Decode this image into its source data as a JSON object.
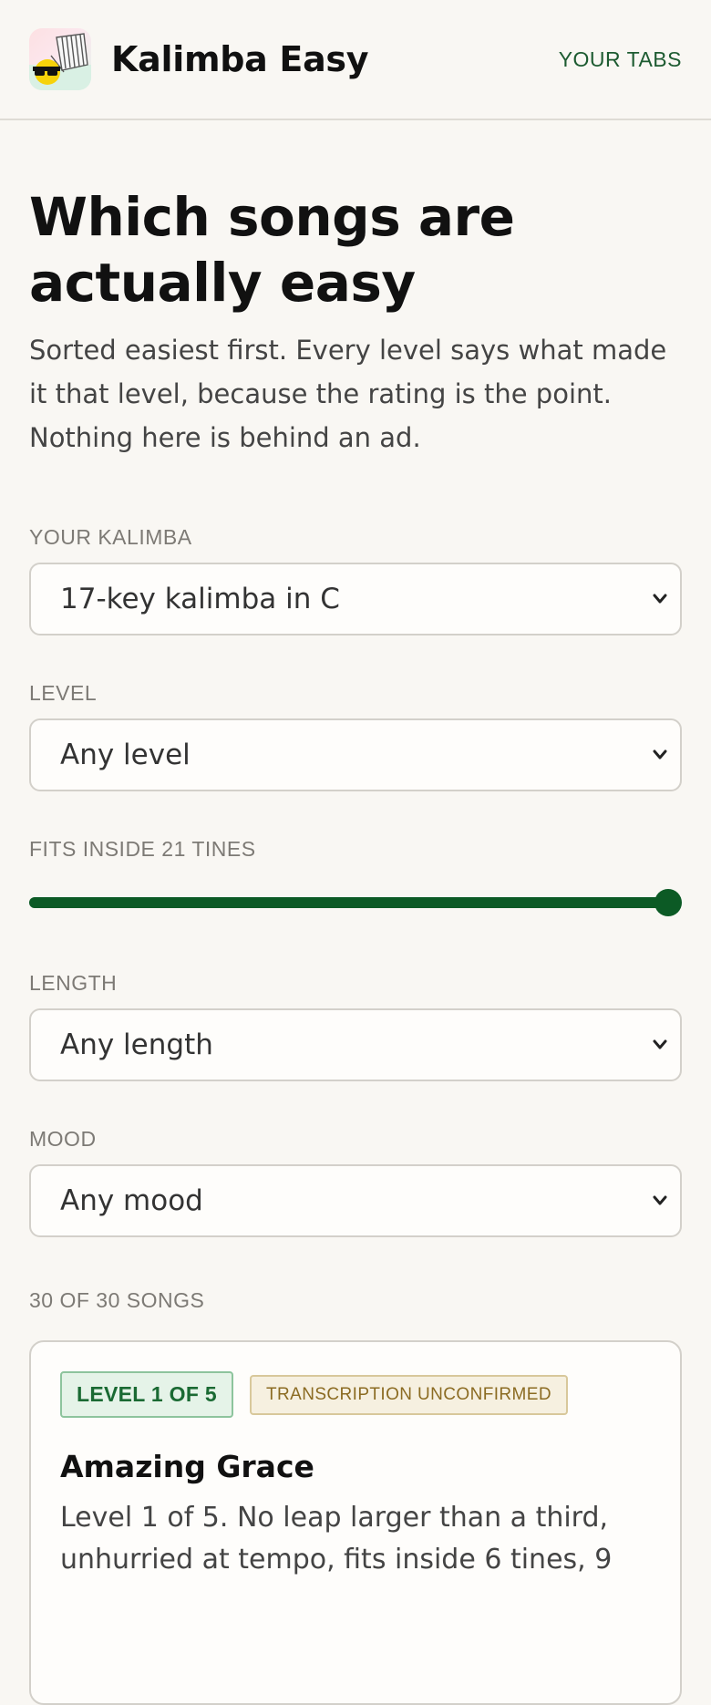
{
  "header": {
    "brand": "Kalimba Easy",
    "nav_link": "YOUR TABS",
    "logo_icon": "kalimba-sunglasses-logo"
  },
  "page": {
    "title": "Which songs are actually easy",
    "intro": "Sorted easiest first. Every level says what made it that level, because the rating is the point. Nothing here is behind an ad."
  },
  "filters": {
    "kalimba": {
      "label": "YOUR KALIMBA",
      "value": "17-key kalimba in C"
    },
    "level": {
      "label": "LEVEL",
      "value": "Any level"
    },
    "tines": {
      "label": "FITS INSIDE 21 TINES",
      "value": 21,
      "max": 21
    },
    "length": {
      "label": "LENGTH",
      "value": "Any length"
    },
    "mood": {
      "label": "MOOD",
      "value": "Any mood"
    }
  },
  "results": {
    "count_text": "30 OF 30 SONGS"
  },
  "songs": [
    {
      "level_badge": "LEVEL 1 OF 5",
      "status_badge": "TRANSCRIPTION UNCONFIRMED",
      "title": "Amazing Grace",
      "description": "Level 1 of 5. No leap larger than a third, unhurried at tempo, fits inside 6 tines, 9"
    }
  ],
  "colors": {
    "accent": "#0c5a25",
    "background": "#f9f7f3",
    "level_badge_bg": "#e5f3e8",
    "unconfirmed_badge_bg": "#f6f0e0"
  }
}
